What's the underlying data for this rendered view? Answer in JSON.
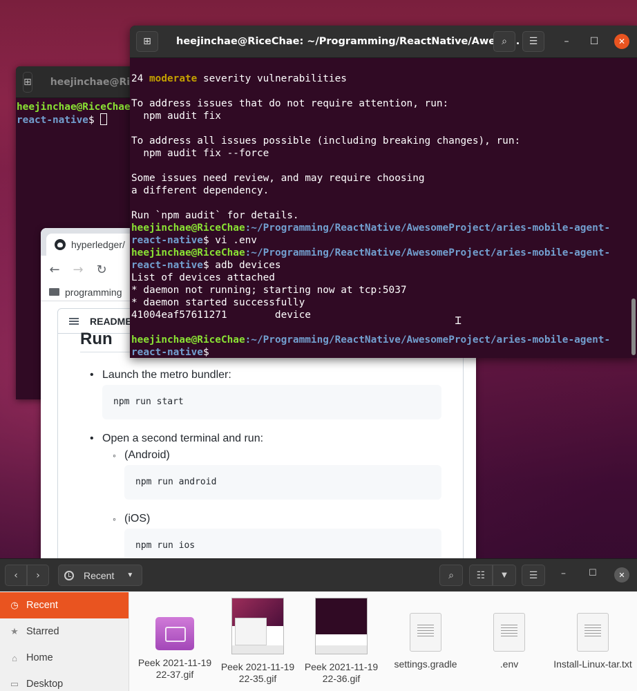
{
  "bg_terminal": {
    "title": "heejinchae@RiceChae",
    "prompt_user": "heejinchae@RiceChae",
    "prompt_dir": "react-native",
    "prompt_symbol": "$ "
  },
  "browser": {
    "tab_title": "hyperledger/",
    "bookmark_folder": "programming",
    "readme_label": "README.md",
    "heading": "Run",
    "items": [
      {
        "text": "Launch the metro bundler:",
        "code": "npm run start"
      },
      {
        "text": "Open a second terminal and run:"
      }
    ],
    "subitems": [
      {
        "text": "(Android)",
        "code": "npm run android"
      },
      {
        "text": "(iOS)",
        "code": "npm run ios"
      }
    ]
  },
  "terminal": {
    "title": "heejinchae@RiceChae: ~/Programming/ReactNative/Awеso...",
    "user_host": "heejinchae@RiceChae",
    "path_line1": ":~/Programming/ReactNative/AwesomeProject/aries-mobile-agent-",
    "path_line2": "react-native",
    "lines": {
      "vuln_count": "24 ",
      "vuln_word": "moderate",
      "vuln_rest": " severity vulnerabilities",
      "l2": "To address issues that do not require attention, run:",
      "l3": "  npm audit fix",
      "l4": "To address all issues possible (including breaking changes), run:",
      "l5": "  npm audit fix --force",
      "l6": "Some issues need review, and may require choosing",
      "l7": "a different dependency.",
      "l8": "Run `npm audit` for details.",
      "cmd1": "$ vi .env",
      "cmd2": "$ adb devices",
      "out1": "List of devices attached",
      "out2": "* daemon not running; starting now at tcp:5037",
      "out3": "* daemon started successfully",
      "out4": "41004eaf57611271        device",
      "cmd3": "$ "
    }
  },
  "files": {
    "location": "Recent",
    "sidebar": [
      {
        "label": "Recent",
        "icon": "clock-icon",
        "active": true
      },
      {
        "label": "Starred",
        "icon": "star-icon",
        "active": false
      },
      {
        "label": "Home",
        "icon": "home-icon",
        "active": false
      },
      {
        "label": "Desktop",
        "icon": "desktop-icon",
        "active": false
      }
    ],
    "items": [
      {
        "name": "Peek 2021-11-19 22-37.gif"
      },
      {
        "name": "Peek 2021-11-19 22-35.gif"
      },
      {
        "name": "Peek 2021-11-19 22-36.gif"
      },
      {
        "name": "settings.gradle"
      },
      {
        "name": ".env"
      },
      {
        "name": "Install-Linux-tar.txt"
      }
    ]
  },
  "colors": {
    "accent": "#e95420",
    "terminal_bg": "#300a24",
    "prompt_green": "#8ae234",
    "prompt_blue": "#729fcf"
  }
}
